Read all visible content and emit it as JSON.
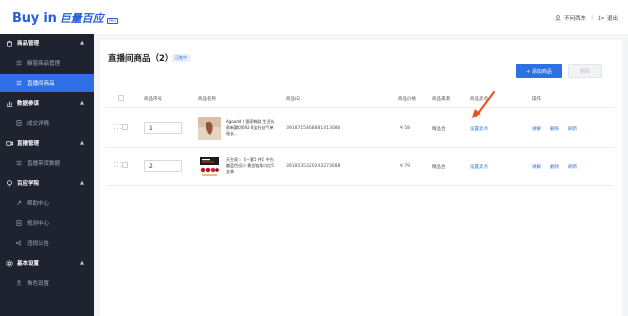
{
  "brand": {
    "name": "Buy in",
    "cn": "巨量百应",
    "tag": "PRO"
  },
  "header": {
    "user": "不问西东",
    "logout": "退出"
  },
  "sidebar": {
    "groups": [
      {
        "label": "商品管理",
        "icon": "goods-icon"
      },
      {
        "label": "数据参谋",
        "icon": "chart-icon"
      },
      {
        "label": "直播管理",
        "icon": "live-icon"
      },
      {
        "label": "百应学院",
        "icon": "academy-icon"
      },
      {
        "label": "基本设置",
        "icon": "settings-icon"
      }
    ],
    "items": [
      {
        "label": "橱窗商品管理"
      },
      {
        "label": "直播间商品"
      },
      {
        "label": "成交详情"
      },
      {
        "label": "直播带货数据"
      },
      {
        "label": "帮助中心"
      },
      {
        "label": "规则中心"
      },
      {
        "label": "违规公告"
      },
      {
        "label": "角色设置"
      }
    ]
  },
  "main": {
    "title": "直播间商品（2）",
    "badge": "正推中",
    "add_button": "+ 添加商品",
    "delete_button": "删除",
    "columns": [
      "商品序号",
      "商品名称",
      "商品ID",
      "商品价格",
      "商品来源",
      "商品卖点",
      "操作"
    ],
    "rows": [
      {
        "seq": "1",
        "name": "Agoodd丨银家韩剧 生活长款新疆切692 8宝针丝气单瑶长...",
        "id": "3918715468881413086",
        "price": "¥ 58",
        "source": "精品合",
        "selling_point": "设置卖点",
        "actions": [
          "讲解",
          "删除",
          "刷新"
        ]
      },
      {
        "seq": "2",
        "name": "天生丽丨【一套5 件】中古趣蓝色设小 黄金链条口红5支装",
        "id": "3918535320243273088",
        "price": "¥ 79",
        "source": "精品合",
        "selling_point": "设置卖点",
        "actions": [
          "讲解",
          "删除",
          "刷新"
        ]
      }
    ]
  },
  "colors": {
    "accent": "#2f6fe6",
    "sidebar_bg": "#1f2330",
    "arrow": "#e8501f"
  }
}
